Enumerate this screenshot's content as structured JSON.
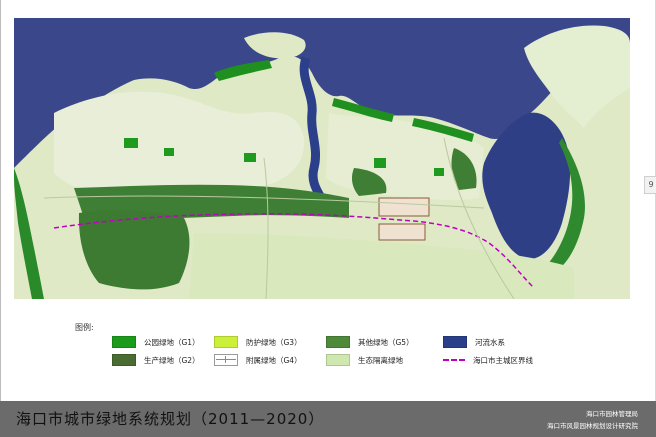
{
  "side_tab": "9",
  "legend": {
    "title": "图例:",
    "items": [
      {
        "label": "公园绿地（G1）",
        "color": "#1a9c1a",
        "style": "fill"
      },
      {
        "label": "防护绿地（G3）",
        "color": "#ccf03a",
        "style": "fill"
      },
      {
        "label": "其他绿地（G5）",
        "color": "#4e8a3a",
        "style": "fill"
      },
      {
        "label": "河流水系",
        "color": "#2a3f8a",
        "style": "fill"
      },
      {
        "label": "生产绿地（G2）",
        "color": "#4a6b32",
        "style": "fill"
      },
      {
        "label": "附属绿地（G4）",
        "color": "#6aa84f",
        "style": "line"
      },
      {
        "label": "生态隔离绿地",
        "color": "#cfe8b0",
        "style": "fill"
      },
      {
        "label": "海口市主城区界线",
        "color": "#c000c0",
        "style": "dash"
      }
    ]
  },
  "footer": {
    "title": "海口市城市绿地系统规划（2011—2020）",
    "org_line1": "海口市园林管理局",
    "org_line2": "海口市风景园林规划设计研究院"
  }
}
